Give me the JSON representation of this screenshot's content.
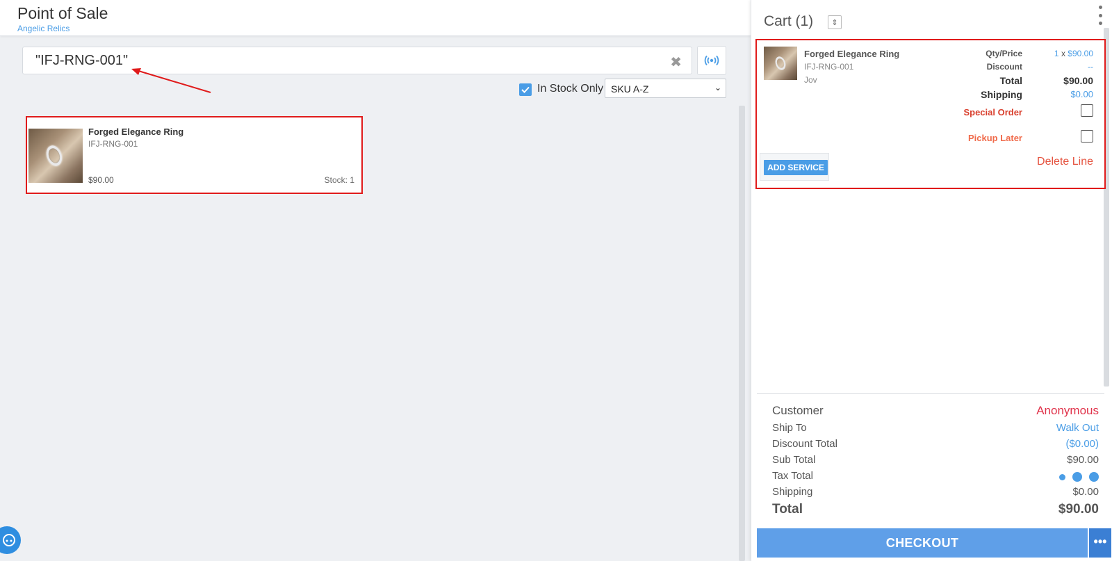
{
  "header": {
    "title": "Point of Sale",
    "subtitle": "Angelic Relics"
  },
  "search": {
    "value": "\"IFJ-RNG-001\"",
    "clear_icon": "close-icon",
    "scan_icon": "broadcast-icon"
  },
  "filters": {
    "in_stock_label": "In Stock Only",
    "in_stock_checked": true,
    "sort_value": "SKU A-Z"
  },
  "product": {
    "name": "Forged Elegance Ring",
    "sku": "IFJ-RNG-001",
    "price": "$90.00",
    "stock": "Stock: 1"
  },
  "cart": {
    "title": "Cart (1)",
    "line": {
      "name": "Forged Elegance Ring",
      "sku": "IFJ-RNG-001",
      "vendor": "Jov",
      "qty_price_label": "Qty/Price",
      "qty": "1",
      "qty_x": "x",
      "price": "$90.00",
      "discount_label": "Discount",
      "discount_value": "--",
      "total_label": "Total",
      "total_value": "$90.00",
      "shipping_label": "Shipping",
      "shipping_value": "$0.00",
      "special_order_label": "Special Order",
      "pickup_later_label": "Pickup Later",
      "add_service_label": "ADD SERVICE",
      "delete_line_label": "Delete Line"
    },
    "summary": {
      "customer_label": "Customer",
      "customer_value": "Anonymous",
      "ship_to_label": "Ship To",
      "ship_to_value": "Walk Out",
      "discount_total_label": "Discount Total",
      "discount_total_value": "($0.00)",
      "sub_total_label": "Sub Total",
      "sub_total_value": "$90.00",
      "tax_total_label": "Tax Total",
      "shipping_label": "Shipping",
      "shipping_value": "$0.00",
      "total_label": "Total",
      "total_value": "$90.00"
    },
    "checkout_label": "CHECKOUT",
    "checkout_more": "•••"
  },
  "colors": {
    "accent": "#4a9de6",
    "annotation": "#e01b1b",
    "customer": "#e0324a",
    "checkout": "#5f9fe8"
  }
}
